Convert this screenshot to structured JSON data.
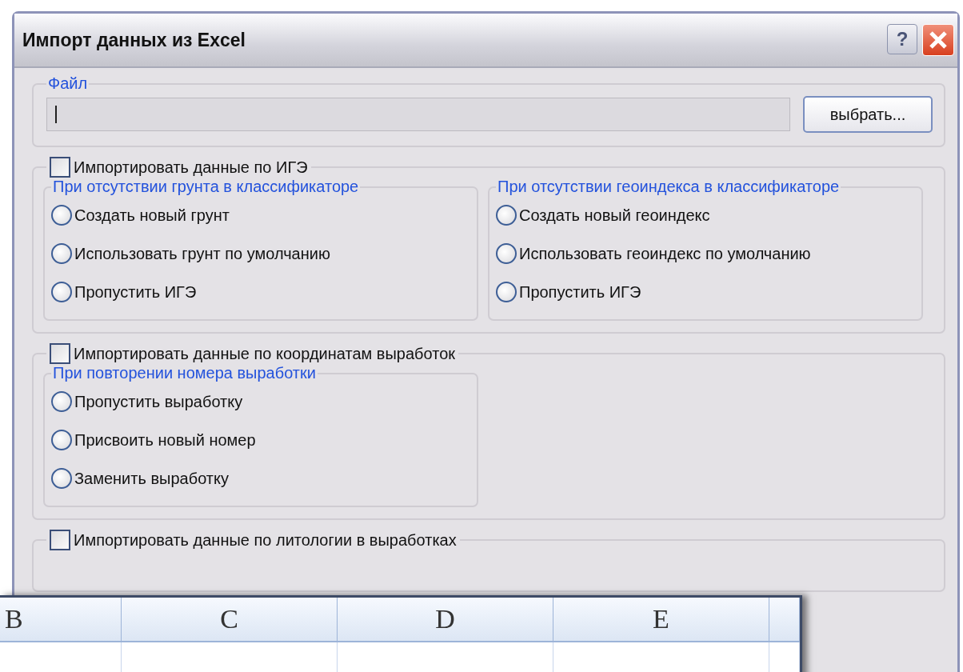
{
  "window": {
    "title": "Импорт данных из Excel",
    "help_button": "?"
  },
  "file_group": {
    "label": "Файл",
    "browse_button": "выбрать..."
  },
  "sections": [
    {
      "label": "Импортировать данные по ИГЭ",
      "checked": false,
      "groups": [
        {
          "title": "При отсутствии грунта в классификаторе",
          "options": [
            {
              "label": "Создать новый грунт",
              "selected": false
            },
            {
              "label": "Использовать грунт по умолчанию",
              "selected": false
            },
            {
              "label": "Пропустить ИГЭ",
              "selected": false
            }
          ]
        },
        {
          "title": "При отсутствии геоиндекса в классификаторе",
          "options": [
            {
              "label": "Создать новый геоиндекс",
              "selected": false
            },
            {
              "label": "Использовать геоиндекс по умолчанию",
              "selected": false
            },
            {
              "label": "Пропустить ИГЭ",
              "selected": false
            }
          ]
        }
      ]
    },
    {
      "label": "Импортировать данные по координатам выработок",
      "checked": false,
      "groups": [
        {
          "title": "При повторении номера выработки",
          "options": [
            {
              "label": "Пропустить выработку",
              "selected": false
            },
            {
              "label": "Присвоить новый номер",
              "selected": false
            },
            {
              "label": "Заменить выработку",
              "selected": false
            }
          ]
        }
      ]
    },
    {
      "label": "Импортировать данные по литологии в выработках",
      "checked": false
    }
  ],
  "spreadsheet": {
    "columns": [
      "B",
      "C",
      "D",
      "E"
    ]
  }
}
